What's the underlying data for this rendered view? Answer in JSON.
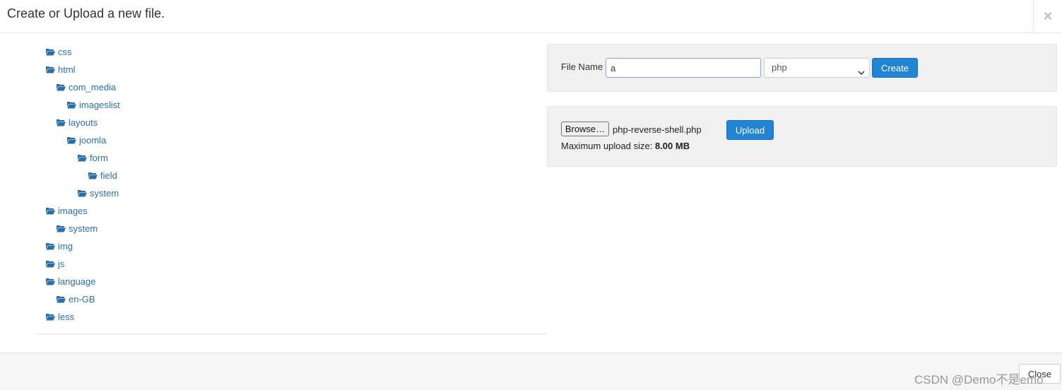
{
  "dialog": {
    "title": "Create or Upload a new file.",
    "close_icon": "×"
  },
  "tree": {
    "icon": "folder-open-icon",
    "items": [
      {
        "label": "css"
      },
      {
        "label": "html"
      },
      {
        "label": "com_media"
      },
      {
        "label": "imageslist"
      },
      {
        "label": "layouts"
      },
      {
        "label": "joomla"
      },
      {
        "label": "form"
      },
      {
        "label": "field"
      },
      {
        "label": "system"
      },
      {
        "label": "images"
      },
      {
        "label": "system"
      },
      {
        "label": "img"
      },
      {
        "label": "js"
      },
      {
        "label": "language"
      },
      {
        "label": "en-GB"
      },
      {
        "label": "less"
      }
    ]
  },
  "create": {
    "label": "File Name",
    "value": "a",
    "extension": "php",
    "button": "Create"
  },
  "upload": {
    "browse_button": "Browse…",
    "chosen_file": "php-reverse-shell.php",
    "button": "Upload",
    "max_label": "Maximum upload size: ",
    "max_value": "8.00 MB"
  },
  "footer": {
    "close_button": "Close"
  },
  "watermark": "CSDN @Demo不是emo",
  "colors": {
    "link": "#2a6fa8",
    "primary": "#2384d3",
    "panel": "#f0f0f0"
  }
}
